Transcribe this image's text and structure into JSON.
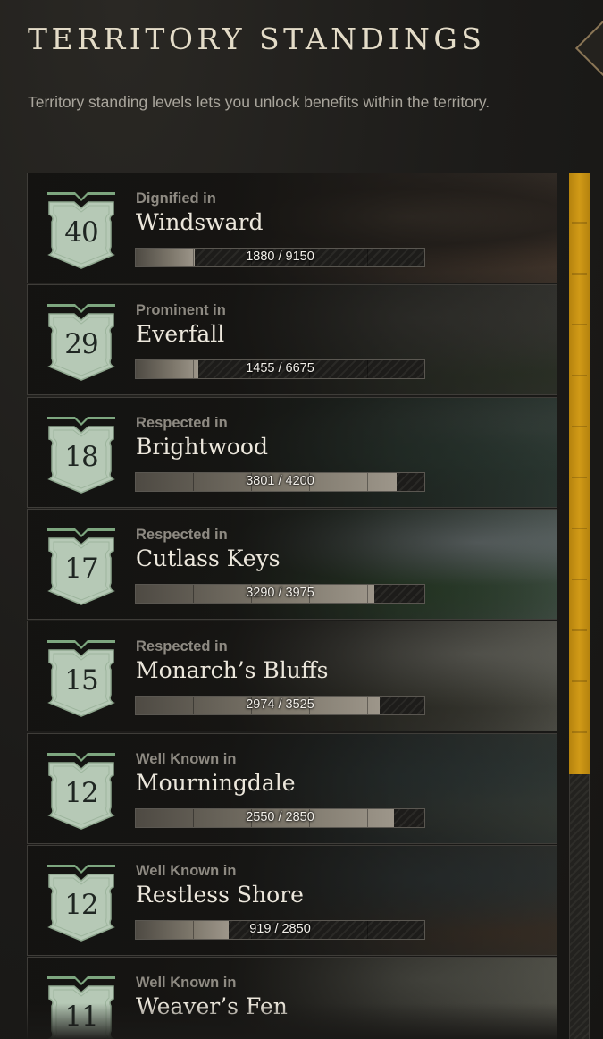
{
  "panel": {
    "title": "TERRITORY STANDINGS",
    "description": "Territory standing levels lets you unlock benefits within the territory."
  },
  "colors": {
    "accent": "#d19a17",
    "badge": "#b6c9b6",
    "badge_trim": "#7da67f"
  },
  "territories": [
    {
      "level": "40",
      "standing": "Dignified in",
      "name": "Windsward",
      "progress": "1880 / 9150",
      "fraction": 0.205,
      "scene": "rocky-arch"
    },
    {
      "level": "29",
      "standing": "Prominent in",
      "name": "Everfall",
      "progress": "1455 / 6675",
      "fraction": 0.218,
      "scene": "cliff-forest"
    },
    {
      "level": "18",
      "standing": "Respected in",
      "name": "Brightwood",
      "progress": "3801 / 4200",
      "fraction": 0.905,
      "scene": "dark-forest"
    },
    {
      "level": "17",
      "standing": "Respected in",
      "name": "Cutlass Keys",
      "progress": "3290 / 3975",
      "fraction": 0.828,
      "scene": "sea-arch"
    },
    {
      "level": "15",
      "standing": "Respected in",
      "name": "Monarch’s Bluffs",
      "progress": "2974 / 3525",
      "fraction": 0.844,
      "scene": "misty-forest"
    },
    {
      "level": "12",
      "standing": "Well Known in",
      "name": "Mourningdale",
      "progress": "2550 / 2850",
      "fraction": 0.895,
      "scene": "village"
    },
    {
      "level": "12",
      "standing": "Well Known in",
      "name": "Restless Shore",
      "progress": "919 / 2850",
      "fraction": 0.322,
      "scene": "shore"
    },
    {
      "level": "11",
      "standing": "Well Known in",
      "name": "Weaver’s Fen",
      "progress": "",
      "fraction": 0,
      "scene": "fen"
    }
  ],
  "scrollbar": {
    "position": 0.0,
    "visible_fraction": 0.695
  }
}
